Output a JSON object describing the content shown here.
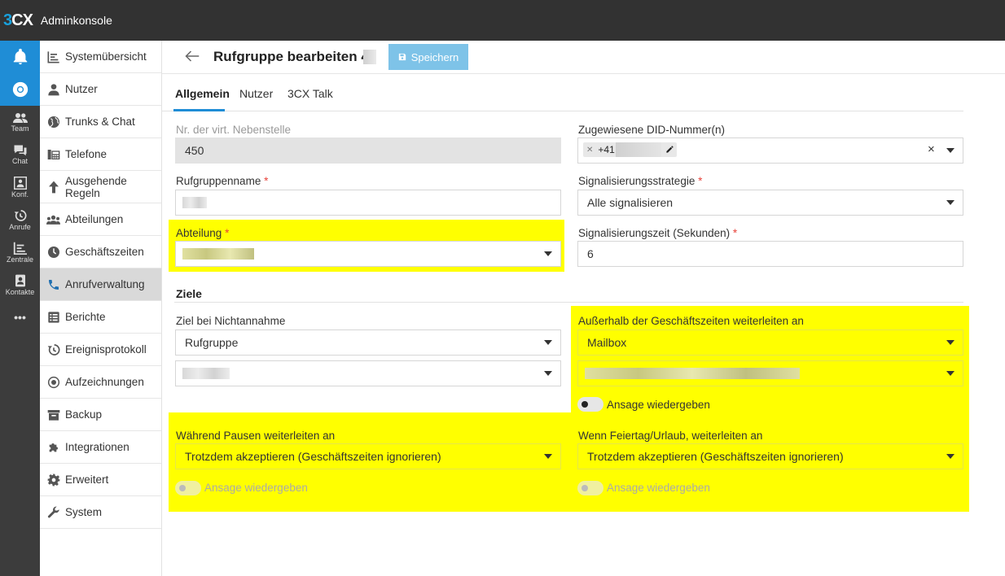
{
  "app": {
    "logo_3": "3",
    "logo_cx": "CX",
    "title": "Adminkonsole"
  },
  "rail": {
    "items": [
      {
        "icon": "bell-icon",
        "label": ""
      },
      {
        "icon": "chrome-icon",
        "label": ""
      },
      {
        "icon": "team-icon",
        "label": "Team"
      },
      {
        "icon": "chat-icon",
        "label": "Chat"
      },
      {
        "icon": "conference-icon",
        "label": "Konf."
      },
      {
        "icon": "calls-history-icon",
        "label": "Anrufe"
      },
      {
        "icon": "switchboard-icon",
        "label": "Zentrale"
      },
      {
        "icon": "contacts-icon",
        "label": "Kontakte"
      },
      {
        "icon": "more-icon",
        "label": "•••"
      }
    ]
  },
  "nav": {
    "items": [
      {
        "label": "Systemübersicht",
        "icon": "dashboard-icon"
      },
      {
        "label": "Nutzer",
        "icon": "user-icon"
      },
      {
        "label": "Trunks & Chat",
        "icon": "globe-icon"
      },
      {
        "label": "Telefone",
        "icon": "phones-icon"
      },
      {
        "label": "Ausgehende Regeln",
        "icon": "arrow-up-icon"
      },
      {
        "label": "Abteilungen",
        "icon": "groups-icon"
      },
      {
        "label": "Geschäftszeiten",
        "icon": "clock-icon"
      },
      {
        "label": "Anrufverwaltung",
        "icon": "phone-icon"
      },
      {
        "label": "Berichte",
        "icon": "reports-icon"
      },
      {
        "label": "Ereignisprotokoll",
        "icon": "history-icon"
      },
      {
        "label": "Aufzeichnungen",
        "icon": "record-icon"
      },
      {
        "label": "Backup",
        "icon": "archive-icon"
      },
      {
        "label": "Integrationen",
        "icon": "puzzle-icon"
      },
      {
        "label": "Erweitert",
        "icon": "gear-icon"
      },
      {
        "label": "System",
        "icon": "wrench-icon"
      }
    ],
    "active_index": 7
  },
  "header": {
    "title": "Rufgruppe bearbeiten 4",
    "save_label": "Speichern"
  },
  "tabs": [
    "Allgemein",
    "Nutzer",
    "3CX Talk"
  ],
  "form": {
    "ext_label": "Nr. der virt. Nebenstelle",
    "ext_value": "450",
    "did_label": "Zugewiesene DID-Nummer(n)",
    "did_chip_value": "+41",
    "did_clear": "×",
    "name_label": "Rufgruppenname",
    "strategy_label": "Signalisierungsstrategie",
    "strategy_value": "Alle signalisieren",
    "dept_label": "Abteilung",
    "ring_time_label": "Signalisierungszeit (Sekunden)",
    "ring_time_value": "6",
    "required_mark": "*"
  },
  "destinations": {
    "title": "Ziele",
    "no_answer_label": "Ziel bei Nichtannahme",
    "no_answer_value": "Rufgruppe",
    "outside_hours_label": "Außerhalb der Geschäftszeiten weiterleiten an",
    "outside_hours_value": "Mailbox",
    "outside_hours_toggle_label": "Ansage wiedergeben",
    "breaks_label": "Während Pausen weiterleiten an",
    "breaks_value": "Trotzdem akzeptieren (Geschäftszeiten ignorieren)",
    "breaks_toggle_label": "Ansage wiedergeben",
    "holiday_label": "Wenn Feiertag/Urlaub, weiterleiten an",
    "holiday_value": "Trotzdem akzeptieren (Geschäftszeiten ignorieren)",
    "holiday_toggle_label": "Ansage wiedergeben"
  },
  "colors": {
    "accent": "#1f8dd6",
    "highlight": "#ffff00",
    "topbar": "#323232",
    "rail": "#3c3c3c",
    "save_button": "#7ec3e8"
  }
}
